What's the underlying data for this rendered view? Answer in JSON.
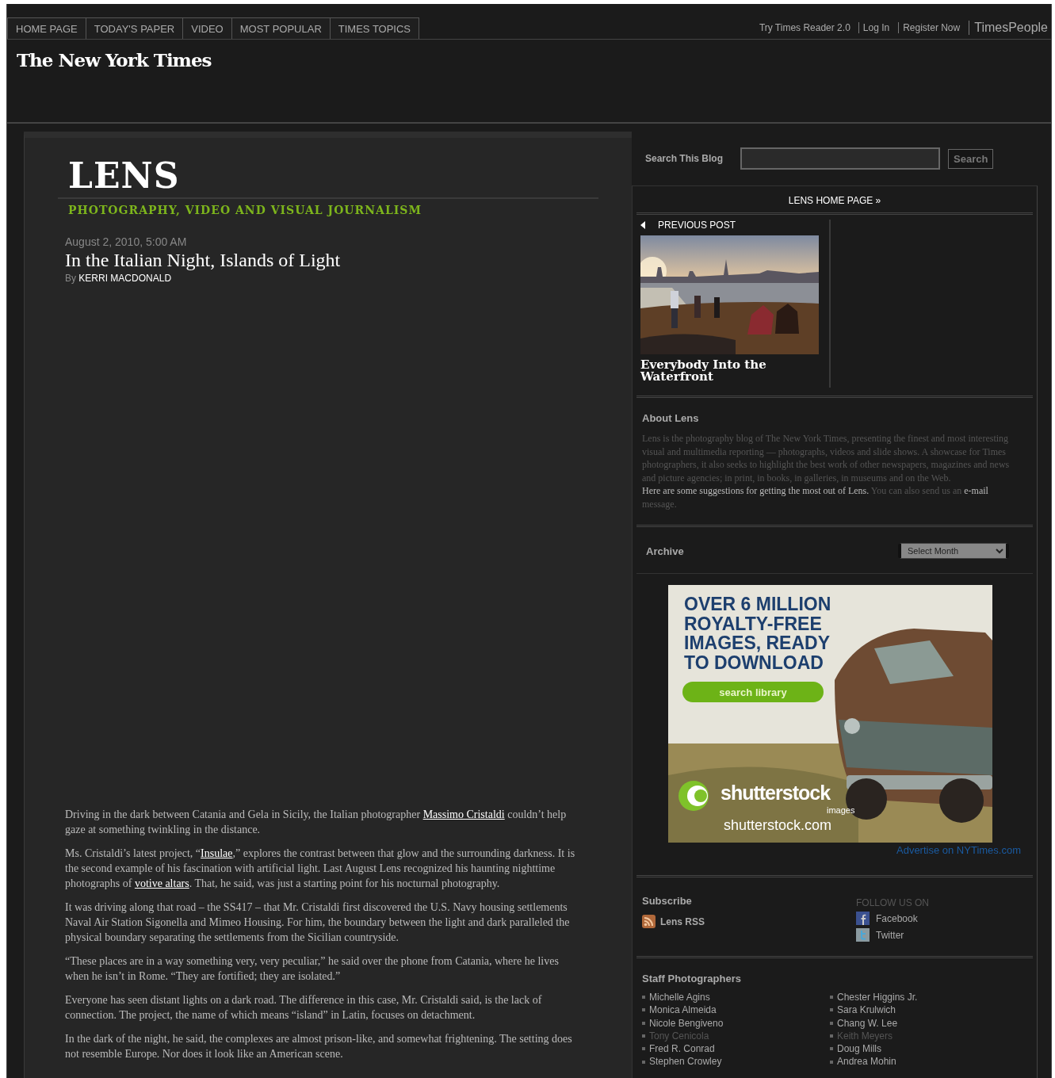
{
  "top_nav": {
    "tabs": [
      {
        "label": "HOME PAGE"
      },
      {
        "label": "TODAY'S PAPER"
      },
      {
        "label": "VIDEO"
      },
      {
        "label": "MOST POPULAR"
      },
      {
        "label": "TIMES TOPICS"
      }
    ],
    "links": [
      {
        "label": "Try Times Reader 2.0",
        "kind": "plain"
      },
      {
        "label": "Log In",
        "kind": "boxed"
      },
      {
        "label": "Register Now",
        "kind": "boxed"
      },
      {
        "label": "TimesPeople",
        "kind": "large"
      }
    ]
  },
  "masthead": {
    "logo": "The New York Times"
  },
  "blog": {
    "title": "LENS",
    "tagline": "PHOTOGRAPHY, VIDEO AND VISUAL JOURNALISM"
  },
  "article": {
    "dateline": "August 2, 2010, 5:00 AM",
    "headline": "In the Italian Night, Islands of Light",
    "by": "By",
    "author": "KERRI MACDONALD",
    "paragraphs": [
      [
        {
          "kind": "text",
          "text": "Driving in the dark between Catania and Gela in Sicily, the Italian photographer "
        },
        {
          "kind": "link",
          "text": "Massimo Cristaldi"
        },
        {
          "kind": "text",
          "text": " couldn’t help gaze at something twinkling in the distance."
        }
      ],
      [
        {
          "kind": "text",
          "text": "Ms. Cristaldi’s latest project, “"
        },
        {
          "kind": "link",
          "text": "Insulae"
        },
        {
          "kind": "text",
          "text": ",” explores the contrast between that glow and the surrounding darkness. It is the second example of his fascination with artificial light. Last August Lens recognized his haunting nighttime photographs of "
        },
        {
          "kind": "link",
          "text": "votive altars"
        },
        {
          "kind": "text",
          "text": ".  That, he said, was just a starting point for his nocturnal photography."
        }
      ],
      [
        {
          "kind": "text",
          "text": "It was driving along that road – the SS417 – that Mr. Cristaldi first discovered the U.S. Navy housing settlements Naval Air Station Sigonella and Mimeo Housing. For him, the boundary between the light and dark paralleled the physical boundary separating the settlements from the Sicilian countryside."
        }
      ],
      [
        {
          "kind": "text",
          "text": "“These places are in a way something very, very peculiar,” he said over the phone from Catania, where he lives when he isn’t in Rome. “They are fortified; they are isolated.”"
        }
      ],
      [
        {
          "kind": "text",
          "text": "Everyone has seen distant lights on a dark road. The difference in this case, Mr. Cristaldi said, is the lack of connection. The project, the name of which means “island” in Latin, focuses on detachment."
        }
      ],
      [
        {
          "kind": "text",
          "text": "In the dark of the night, he said, the complexes are almost prison-like, and somewhat frightening. The setting does not resemble Europe. Nor does it look like an American scene."
        }
      ]
    ]
  },
  "sidebar": {
    "search": {
      "label": "Search This Blog",
      "button": "Search"
    },
    "home_link": "LENS HOME PAGE »",
    "previous_post": {
      "label": "PREVIOUS POST",
      "title": "Everybody Into the Waterfront"
    },
    "about": {
      "heading": "About Lens",
      "parts": [
        {
          "kind": "text",
          "text": "Lens is the photography blog of The New York Times, presenting the finest and most interesting visual and multimedia reporting — photographs, videos and slide shows. A showcase for Times photographers, it also seeks to highlight the best work of other newspapers, magazines and news and picture agencies; in print, in books, in galleries, in museums and on the Web. "
        },
        {
          "kind": "link",
          "text": "Here are some suggestions for getting the most out of Lens."
        },
        {
          "kind": "text",
          "text": " You can also send us an "
        },
        {
          "kind": "link",
          "text": "e-mail"
        },
        {
          "kind": "text",
          "text": " message."
        }
      ]
    },
    "archive": {
      "heading": "Archive",
      "placeholder": "Select Month"
    },
    "ad": {
      "headline": "OVER 6 MILLION ROYALTY-FREE IMAGES, READY TO DOWNLOAD",
      "button": "search library",
      "brand": "shutterstock",
      "brand_sub": "images",
      "url": "shutterstock.com",
      "advertise": "Advertise on NYTimes.com"
    },
    "subscribe": {
      "heading": "Subscribe",
      "rss": "Lens RSS"
    },
    "follow": {
      "heading": "FOLLOW US ON",
      "items": [
        {
          "kind": "facebook",
          "label": "Facebook"
        },
        {
          "kind": "twitter",
          "label": "Twitter"
        }
      ]
    },
    "staff": {
      "heading": "Staff Photographers",
      "columns": [
        [
          {
            "name": "Michelle Agins",
            "inactive": false
          },
          {
            "name": "Monica Almeida",
            "inactive": false
          },
          {
            "name": "Nicole Bengiveno",
            "inactive": false
          },
          {
            "name": "Tony Cenicola",
            "inactive": true
          },
          {
            "name": "Fred R. Conrad",
            "inactive": false
          },
          {
            "name": "Stephen Crowley",
            "inactive": false
          }
        ],
        [
          {
            "name": "Chester Higgins Jr.",
            "inactive": false
          },
          {
            "name": "Sara Krulwich",
            "inactive": false
          },
          {
            "name": "Chang W. Lee",
            "inactive": false
          },
          {
            "name": "Keith Meyers",
            "inactive": true
          },
          {
            "name": "Doug Mills",
            "inactive": false
          },
          {
            "name": "Andrea Mohin",
            "inactive": false
          }
        ]
      ]
    }
  }
}
